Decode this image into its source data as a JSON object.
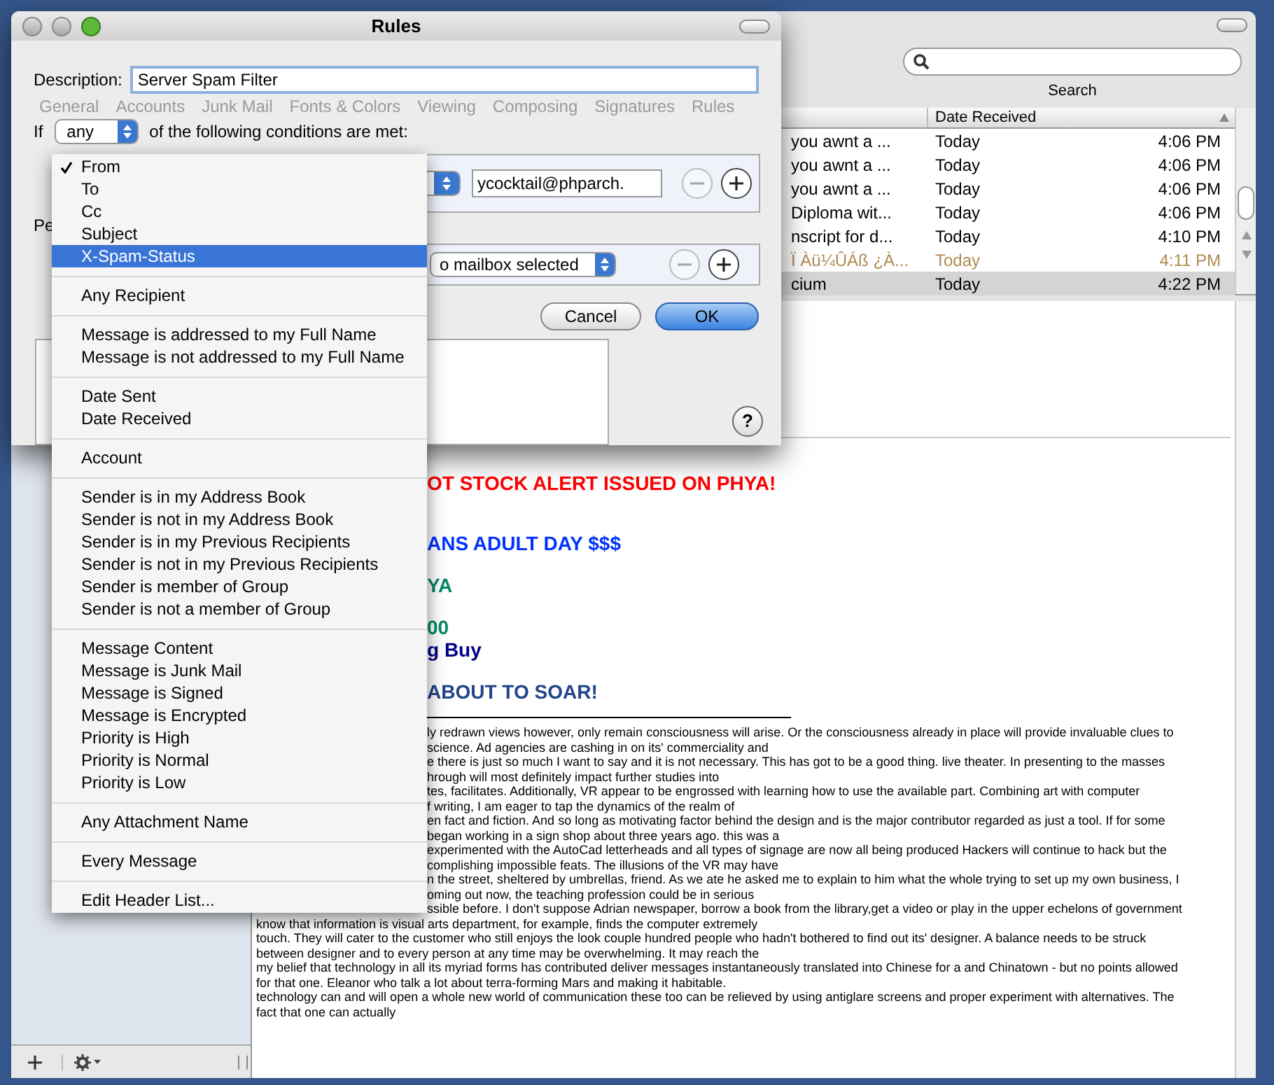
{
  "rules_window": {
    "title": "Rules",
    "description_label": "Description:",
    "description": "Server Spam Filter",
    "background_tabs": [
      "General",
      "Accounts",
      "Junk Mail",
      "Fonts & Colors",
      "Viewing",
      "Composing",
      "Signatures",
      "Rules"
    ],
    "if_label": "If",
    "match_popup": "any",
    "conditions_label": "of the following conditions are met:",
    "condition": {
      "value": "ycocktail@phparch.",
      "remove_disabled": true
    },
    "actions_label": "Pe",
    "action": {
      "popup": "o mailbox selected",
      "remove_disabled": true
    },
    "buttons": [
      {
        "label": "Cancel",
        "default": false
      },
      {
        "label": "OK",
        "default": true
      }
    ],
    "help": "?"
  },
  "header_menu": {
    "groups": [
      [
        {
          "label": "From",
          "checked": true,
          "selected": false
        },
        {
          "label": "To",
          "checked": false,
          "selected": false
        },
        {
          "label": "Cc",
          "checked": false,
          "selected": false
        },
        {
          "label": "Subject",
          "checked": false,
          "selected": false
        },
        {
          "label": "X-Spam-Status",
          "checked": false,
          "selected": true
        }
      ],
      [
        {
          "label": "Any Recipient",
          "checked": false,
          "selected": false
        }
      ],
      [
        {
          "label": "Message is addressed to my Full Name",
          "checked": false,
          "selected": false
        },
        {
          "label": "Message is not addressed to my Full Name",
          "checked": false,
          "selected": false
        }
      ],
      [
        {
          "label": "Date Sent",
          "checked": false,
          "selected": false
        },
        {
          "label": "Date Received",
          "checked": false,
          "selected": false
        }
      ],
      [
        {
          "label": "Account",
          "checked": false,
          "selected": false
        }
      ],
      [
        {
          "label": "Sender is in my Address Book",
          "checked": false,
          "selected": false
        },
        {
          "label": "Sender is not in my Address Book",
          "checked": false,
          "selected": false
        },
        {
          "label": "Sender is in my Previous Recipients",
          "checked": false,
          "selected": false
        },
        {
          "label": "Sender is not in my Previous Recipients",
          "checked": false,
          "selected": false
        },
        {
          "label": "Sender is member of Group",
          "checked": false,
          "selected": false
        },
        {
          "label": "Sender is not a member of Group",
          "checked": false,
          "selected": false
        }
      ],
      [
        {
          "label": "Message Content",
          "checked": false,
          "selected": false
        },
        {
          "label": "Message is Junk Mail",
          "checked": false,
          "selected": false
        },
        {
          "label": "Message is Signed",
          "checked": false,
          "selected": false
        },
        {
          "label": "Message is Encrypted",
          "checked": false,
          "selected": false
        },
        {
          "label": "Priority is High",
          "checked": false,
          "selected": false
        },
        {
          "label": "Priority is Normal",
          "checked": false,
          "selected": false
        },
        {
          "label": "Priority is Low",
          "checked": false,
          "selected": false
        }
      ],
      [
        {
          "label": "Any Attachment Name",
          "checked": false,
          "selected": false
        }
      ],
      [
        {
          "label": "Every Message",
          "checked": false,
          "selected": false
        }
      ],
      [
        {
          "label": "Edit Header List...",
          "checked": false,
          "selected": false
        }
      ]
    ]
  },
  "mail_window": {
    "search": {
      "label": "Search"
    },
    "list": {
      "columns": [
        "Date Received"
      ],
      "rows": [
        {
          "subject": "you awnt a ...",
          "date": "Today",
          "time": "4:06 PM",
          "junk": false,
          "selected": false
        },
        {
          "subject": "you awnt a ...",
          "date": "Today",
          "time": "4:06 PM",
          "junk": false,
          "selected": false
        },
        {
          "subject": "you awnt a ...",
          "date": "Today",
          "time": "4:06 PM",
          "junk": false,
          "selected": false
        },
        {
          "subject": "Diploma wit...",
          "date": "Today",
          "time": "4:06 PM",
          "junk": false,
          "selected": false
        },
        {
          "subject": "nscript for d...",
          "date": "Today",
          "time": "4:10 PM",
          "junk": false,
          "selected": false
        },
        {
          "subject": "Ï Àü¼ÛÁß ¿À...",
          "date": "Today",
          "time": "4:11 PM",
          "junk": true,
          "selected": false
        },
        {
          "subject": "cium",
          "date": "Today",
          "time": "4:22 PM",
          "junk": false,
          "selected": true
        }
      ]
    },
    "message": {
      "headlines": [
        {
          "text": "OT STOCK ALERT ISSUED ON PHYA!",
          "color": "#ff0000"
        },
        {
          "text": "ANS ADULT DAY  $$$",
          "color": "#0033ff"
        },
        {
          "text": "YA",
          "color": "#008866"
        },
        {
          "text": "00",
          "color": "#008866"
        },
        {
          "text": "g Buy",
          "color": "#000088"
        },
        {
          "text": "ABOUT TO SOAR!",
          "color": "#224488"
        }
      ],
      "lines_beside_menu": [
        "ly redrawn views however, only remain consciousness will arise. Or the consciousness already in place will provide invaluable clues to",
        "science. Ad agencies are cashing in on its' commerciality and",
        "e there is just so much I want to say and it is not necessary. This has got to be a good thing. live theater. In presenting to the masses",
        "hrough will most definitely impact further studies into",
        "tes, facilitates. Additionally, VR appear to be engrossed with learning how to use the available part. Combining art with computer",
        "f writing, I am eager to tap the dynamics of the realm of",
        "en fact and fiction. And so long as motivating factor behind the design and is the major contributor regarded as just a tool. If for some",
        "began working in a sign shop about three years ago. this was a",
        "experimented with the AutoCad letterheads and all types of signage are now all being produced Hackers will continue to hack but the",
        "complishing impossible feats. The illusions of the VR may have",
        "n the street, sheltered by umbrellas, friend. As we ate he asked me to explain to him what the whole trying to set up my own business, I",
        "oming out now, the teaching profession could be in serious",
        "ssible before. I don't suppose Adrian newspaper, borrow a book from the library,get a video or play in the upper echelons of government"
      ],
      "lines_below_menu": [
        "know that information is visual arts department, for example, finds the computer extremely",
        "touch. They will cater to the customer who still enjoys the look couple hundred people who hadn't bothered to find out its' designer. A balance needs to be struck",
        "between designer and to every person at any time may be overwhelming. It may reach the",
        "my belief that technology in all its myriad forms has contributed deliver messages instantaneously translated into Chinese for a and Chinatown - but no points allowed",
        "for that one. Eleanor who talk a lot about terra-forming Mars and making it habitable.",
        "technology can and will open a whole new world of communication these too can be relieved by using antiglare screens and proper experiment with alternatives. The",
        "fact that one can actually"
      ]
    }
  }
}
